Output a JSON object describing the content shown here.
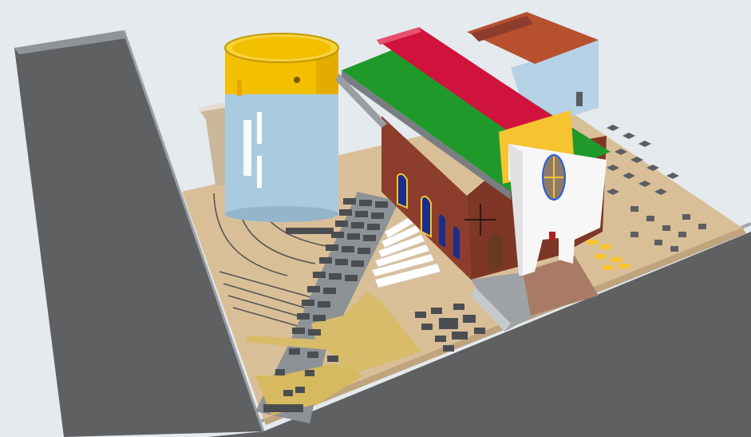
{
  "viewport": {
    "background": "#e4eaee",
    "cursor": "crosshair"
  },
  "colors": {
    "road": "#5f6061",
    "road_edge": "#8f9499",
    "ground": "#d9bf98",
    "ground_light": "#e0caa6",
    "walkway": "#8d9296",
    "paver": "#4b4e51",
    "tower_body": "#a9cbe0",
    "tower_top": "#f3c000",
    "roof_green": "#1f9a2a",
    "roof_red": "#d0133c",
    "roof_rust": "#b6502f",
    "brick": "#8d3d2b",
    "facade": "#f7f7f7",
    "yellow": "#f6c431",
    "side_building": "#b6d2e6",
    "tan_wall": "#cbb79a"
  },
  "icons": {
    "cursor": "crosshair-icon"
  }
}
